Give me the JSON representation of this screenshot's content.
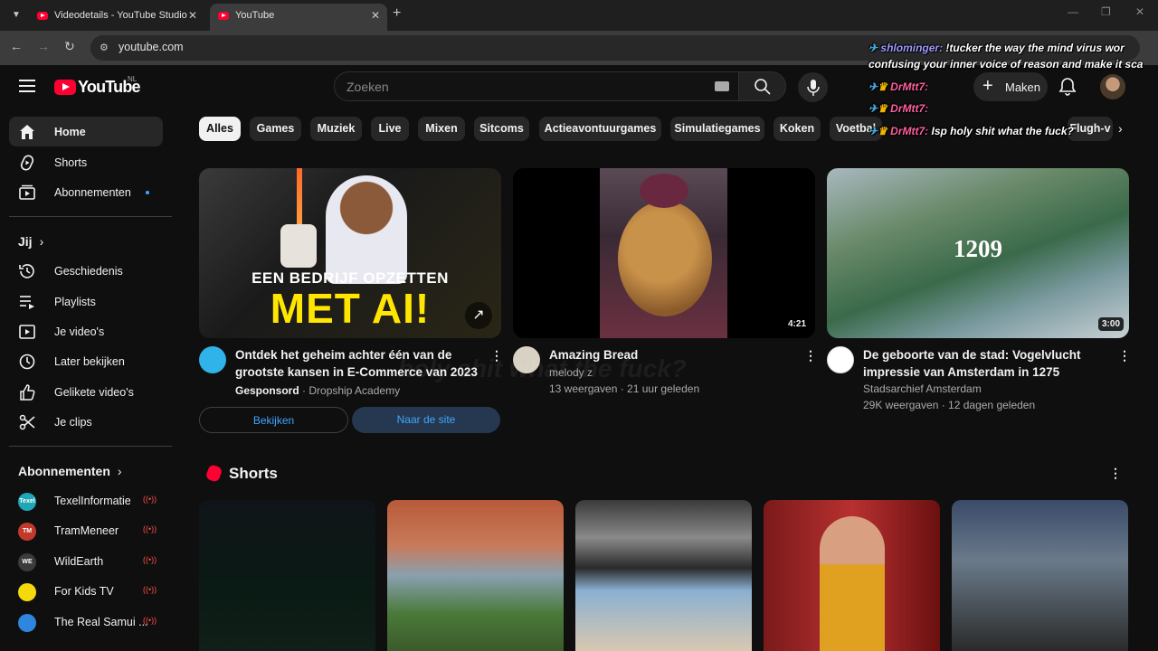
{
  "browser": {
    "tabs": [
      {
        "title": "Videodetails - YouTube Studio",
        "active": false
      },
      {
        "title": "YouTube",
        "active": true
      }
    ],
    "url": "youtube.com"
  },
  "header": {
    "logo_text": "YouTube",
    "country_code": "NL",
    "search_placeholder": "Zoeken",
    "create_label": "Maken"
  },
  "sidebar": {
    "main": [
      {
        "label": "Home",
        "icon": "home-icon",
        "active": true
      },
      {
        "label": "Shorts",
        "icon": "shorts-icon"
      },
      {
        "label": "Abonnementen",
        "icon": "subscriptions-icon",
        "new": true
      }
    ],
    "you_heading": "Jij",
    "you": [
      {
        "label": "Geschiedenis",
        "icon": "history-icon"
      },
      {
        "label": "Playlists",
        "icon": "playlists-icon"
      },
      {
        "label": "Je video's",
        "icon": "your-videos-icon"
      },
      {
        "label": "Later bekijken",
        "icon": "watch-later-icon"
      },
      {
        "label": "Gelikete video's",
        "icon": "liked-videos-icon"
      },
      {
        "label": "Je clips",
        "icon": "clips-icon"
      }
    ],
    "subs_heading": "Abonnementen",
    "subscriptions": [
      {
        "label": "TexelInformatie",
        "avatar_text": "Texel",
        "color": "#1fa7b8",
        "live": true
      },
      {
        "label": "TramMeneer",
        "avatar_text": "TM",
        "color": "#c0392b",
        "live": true
      },
      {
        "label": "WildEarth",
        "avatar_text": "WE",
        "color": "#3b3b3b",
        "live": true
      },
      {
        "label": "For Kids TV",
        "avatar_text": "",
        "color": "#f5d90a",
        "live": true
      },
      {
        "label": "The Real Samui ...",
        "avatar_text": "",
        "color": "#2e86de",
        "live": true
      }
    ]
  },
  "chips": [
    "Alles",
    "Games",
    "Muziek",
    "Live",
    "Mixen",
    "Sitcoms",
    "Actieavontuurgames",
    "Simulatiegames",
    "Koken",
    "Voetbal",
    "Flugh-v"
  ],
  "videos": [
    {
      "title_line1": "Ontdek het geheim achter één van de",
      "title_line2": "grootste kansen in E-Commerce van 2023",
      "sponsored_label": "Gesponsord",
      "channel": "Dropship Academy",
      "thumb_text_top": "EEN BEDRIJF OPZETTEN",
      "thumb_text_big": "MET AI!",
      "buttons": [
        "Bekijken",
        "Naar de site"
      ]
    },
    {
      "title": "Amazing Bread",
      "channel": "melody z",
      "meta": "13 weergaven · 21 uur geleden",
      "duration": "4:21"
    },
    {
      "title_line1": "De geboorte van de stad: Vogelvlucht",
      "title_line2": "impressie van Amsterdam in 1275",
      "channel": "Stadsarchief Amsterdam",
      "meta": "29K weergaven · 12 dagen geleden",
      "duration": "3:00",
      "thumb_text": "1209"
    }
  ],
  "shorts": {
    "heading": "Shorts"
  },
  "chat_overlay": [
    {
      "name": "shlominger:",
      "text": " !tucker the way the mind virus wor"
    },
    {
      "name": "",
      "text": "confusing your inner voice of reason and make it sca"
    },
    {
      "name": "DrMtt7:",
      "text": ""
    },
    {
      "name": "DrMtt7:",
      "text": ""
    },
    {
      "name": "DrMtt7:",
      "text": " Isp holy shit what the fuck?"
    }
  ],
  "ghost_overlay_text": "holy shit what the fuck?"
}
